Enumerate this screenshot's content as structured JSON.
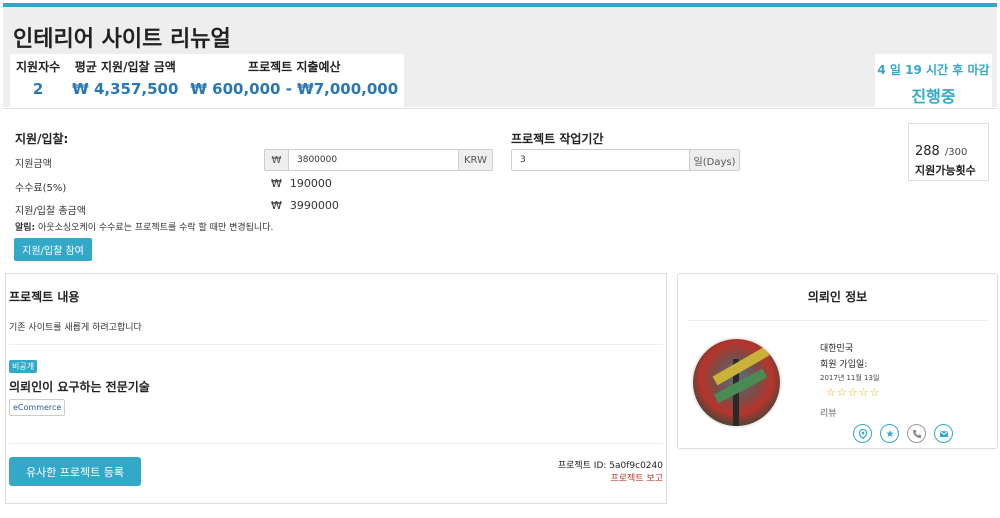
{
  "project": {
    "title": "인테리어 사이트 리뉴얼"
  },
  "stats": [
    {
      "label": "지원자수",
      "value": "2"
    },
    {
      "label": "평균 지원/입찰 금액",
      "value": "₩ 4,357,500"
    },
    {
      "label": "프로젝트 지출예산",
      "value": "₩ 600,000 - ₩7,000,000"
    }
  ],
  "deadline": {
    "time": "4 일 19 시간 후 마감",
    "status": "진행중"
  },
  "bid": {
    "title": "지원/입찰:",
    "amount_label": "지원금액",
    "currency_symbol": "₩",
    "amount_value": "3800000",
    "currency_code": "KRW",
    "fee_label": "수수료(5%)",
    "fee_value": "190000",
    "total_label": "지원/입찰 총금액",
    "total_value": "3990000",
    "notice_prefix": "알림:",
    "notice_text": " 아웃소싱오케이 수수료는 프로젝트를 수락 할 때만 변경됩니다.",
    "submit_label": "지원/입찰 참여"
  },
  "period": {
    "title": "프로젝트 작업기간",
    "value": "3",
    "unit": "일(Days)"
  },
  "remaining": {
    "count": "288",
    "max": "/300",
    "label": "지원가능횟수"
  },
  "content": {
    "title": "프로젝트 내용",
    "description": "기존 사이트를 새롭게 하려고합니다",
    "private_badge": "비공개",
    "skills_title": "의뢰인이 요구하는 전문기술",
    "skills": [
      "eCommerce"
    ],
    "similar_button": "유사한 프로젝트 등록",
    "project_id": "프로젝트 ID: 5a0f9c0240",
    "report_link": "프로젝트 보고"
  },
  "client": {
    "title": "의뢰인 정보",
    "country": "대한민국",
    "joined_label": "회원 가입일:",
    "joined_date": "2017년 11월 13일",
    "stars": "☆☆☆☆☆",
    "review": "리뷰"
  },
  "colors": {
    "accent": "#33a8c9",
    "price": "#2a77b5",
    "link_red": "#c0392b"
  }
}
